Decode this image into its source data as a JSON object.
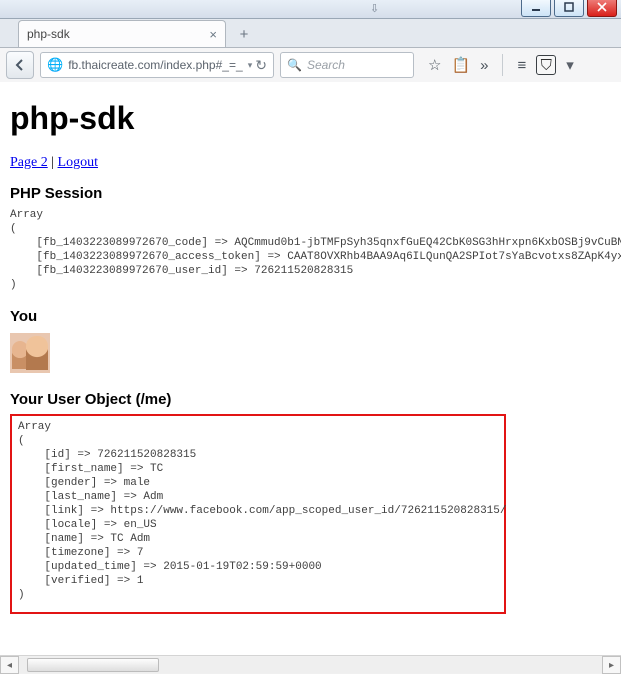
{
  "window": {
    "min_tip": "Minimize",
    "max_tip": "Maximize",
    "close_tip": "Close"
  },
  "tab": {
    "title": "php-sdk"
  },
  "toolbar": {
    "url": "fb.thaicreate.com/index.php#_=_",
    "search_placeholder": "Search"
  },
  "page": {
    "h1": "php-sdk",
    "link_page2": "Page 2",
    "link_sep": " | ",
    "link_logout": "Logout",
    "session_heading": "PHP Session",
    "session_dump": "Array\n(\n    [fb_1403223089972670_code] => AQCmmud0b1-jbTMFpSyh35qnxfGuEQ42CbK0SG3hHrxpn6KxbOSBj9vCuBNUq3vxqf\n    [fb_1403223089972670_access_token] => CAAT8OVXRhb4BAA9Aq6ILQunQA2SPIot7sYaBcvotxs8ZApK4yxx84AYP1\n    [fb_1403223089972670_user_id] => 726211520828315\n)",
    "you_heading": "You",
    "obj_heading": "Your User Object (/me)",
    "obj_dump": "Array\n(\n    [id] => 726211520828315\n    [first_name] => TC\n    [gender] => male\n    [last_name] => Adm\n    [link] => https://www.facebook.com/app_scoped_user_id/726211520828315/\n    [locale] => en_US\n    [name] => TC Adm\n    [timezone] => 7\n    [updated_time] => 2015-01-19T02:59:59+0000\n    [verified] => 1\n)"
  }
}
